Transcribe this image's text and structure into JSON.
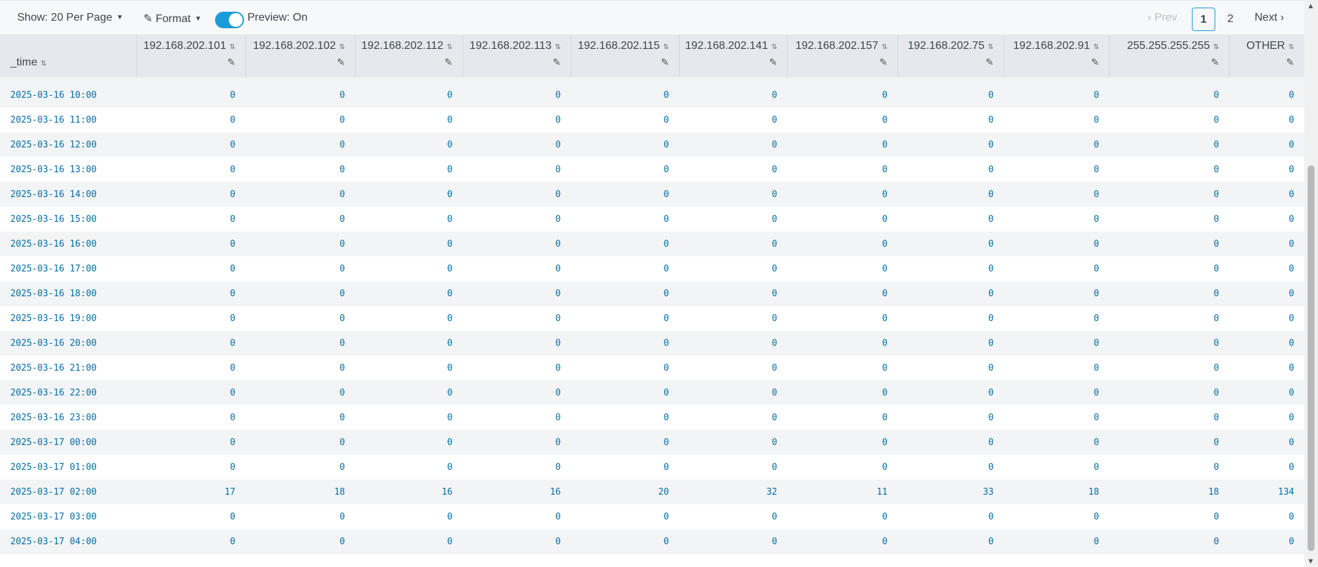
{
  "toolbar": {
    "show_label": "Show: 20 Per Page",
    "format_label": "Format",
    "preview_label": "Preview: On"
  },
  "pager": {
    "prev_label": "Prev",
    "pages": [
      "1",
      "2"
    ],
    "next_label": "Next"
  },
  "table": {
    "columns": [
      "_time",
      "192.168.202.101",
      "192.168.202.102",
      "192.168.202.112",
      "192.168.202.113",
      "192.168.202.115",
      "192.168.202.141",
      "192.168.202.157",
      "192.168.202.75",
      "192.168.202.91",
      "255.255.255.255",
      "OTHER"
    ],
    "rows": [
      [
        "2025-03-16 10:00",
        "0",
        "0",
        "0",
        "0",
        "0",
        "0",
        "0",
        "0",
        "0",
        "0",
        "0"
      ],
      [
        "2025-03-16 11:00",
        "0",
        "0",
        "0",
        "0",
        "0",
        "0",
        "0",
        "0",
        "0",
        "0",
        "0"
      ],
      [
        "2025-03-16 12:00",
        "0",
        "0",
        "0",
        "0",
        "0",
        "0",
        "0",
        "0",
        "0",
        "0",
        "0"
      ],
      [
        "2025-03-16 13:00",
        "0",
        "0",
        "0",
        "0",
        "0",
        "0",
        "0",
        "0",
        "0",
        "0",
        "0"
      ],
      [
        "2025-03-16 14:00",
        "0",
        "0",
        "0",
        "0",
        "0",
        "0",
        "0",
        "0",
        "0",
        "0",
        "0"
      ],
      [
        "2025-03-16 15:00",
        "0",
        "0",
        "0",
        "0",
        "0",
        "0",
        "0",
        "0",
        "0",
        "0",
        "0"
      ],
      [
        "2025-03-16 16:00",
        "0",
        "0",
        "0",
        "0",
        "0",
        "0",
        "0",
        "0",
        "0",
        "0",
        "0"
      ],
      [
        "2025-03-16 17:00",
        "0",
        "0",
        "0",
        "0",
        "0",
        "0",
        "0",
        "0",
        "0",
        "0",
        "0"
      ],
      [
        "2025-03-16 18:00",
        "0",
        "0",
        "0",
        "0",
        "0",
        "0",
        "0",
        "0",
        "0",
        "0",
        "0"
      ],
      [
        "2025-03-16 19:00",
        "0",
        "0",
        "0",
        "0",
        "0",
        "0",
        "0",
        "0",
        "0",
        "0",
        "0"
      ],
      [
        "2025-03-16 20:00",
        "0",
        "0",
        "0",
        "0",
        "0",
        "0",
        "0",
        "0",
        "0",
        "0",
        "0"
      ],
      [
        "2025-03-16 21:00",
        "0",
        "0",
        "0",
        "0",
        "0",
        "0",
        "0",
        "0",
        "0",
        "0",
        "0"
      ],
      [
        "2025-03-16 22:00",
        "0",
        "0",
        "0",
        "0",
        "0",
        "0",
        "0",
        "0",
        "0",
        "0",
        "0"
      ],
      [
        "2025-03-16 23:00",
        "0",
        "0",
        "0",
        "0",
        "0",
        "0",
        "0",
        "0",
        "0",
        "0",
        "0"
      ],
      [
        "2025-03-17 00:00",
        "0",
        "0",
        "0",
        "0",
        "0",
        "0",
        "0",
        "0",
        "0",
        "0",
        "0"
      ],
      [
        "2025-03-17 01:00",
        "0",
        "0",
        "0",
        "0",
        "0",
        "0",
        "0",
        "0",
        "0",
        "0",
        "0"
      ],
      [
        "2025-03-17 02:00",
        "17",
        "18",
        "16",
        "16",
        "20",
        "32",
        "11",
        "33",
        "18",
        "18",
        "134"
      ],
      [
        "2025-03-17 03:00",
        "0",
        "0",
        "0",
        "0",
        "0",
        "0",
        "0",
        "0",
        "0",
        "0",
        "0"
      ],
      [
        "2025-03-17 04:00",
        "0",
        "0",
        "0",
        "0",
        "0",
        "0",
        "0",
        "0",
        "0",
        "0",
        "0"
      ]
    ]
  },
  "colors": {
    "accent": "#1a9bd8",
    "cell_text": "#006eaa",
    "header_bg": "#e5e9ed",
    "stripe_bg": "#f2f4f5"
  },
  "icons": {
    "sort": "sort-icon",
    "edit": "pencil-icon",
    "dropdown": "caret-down-icon"
  }
}
